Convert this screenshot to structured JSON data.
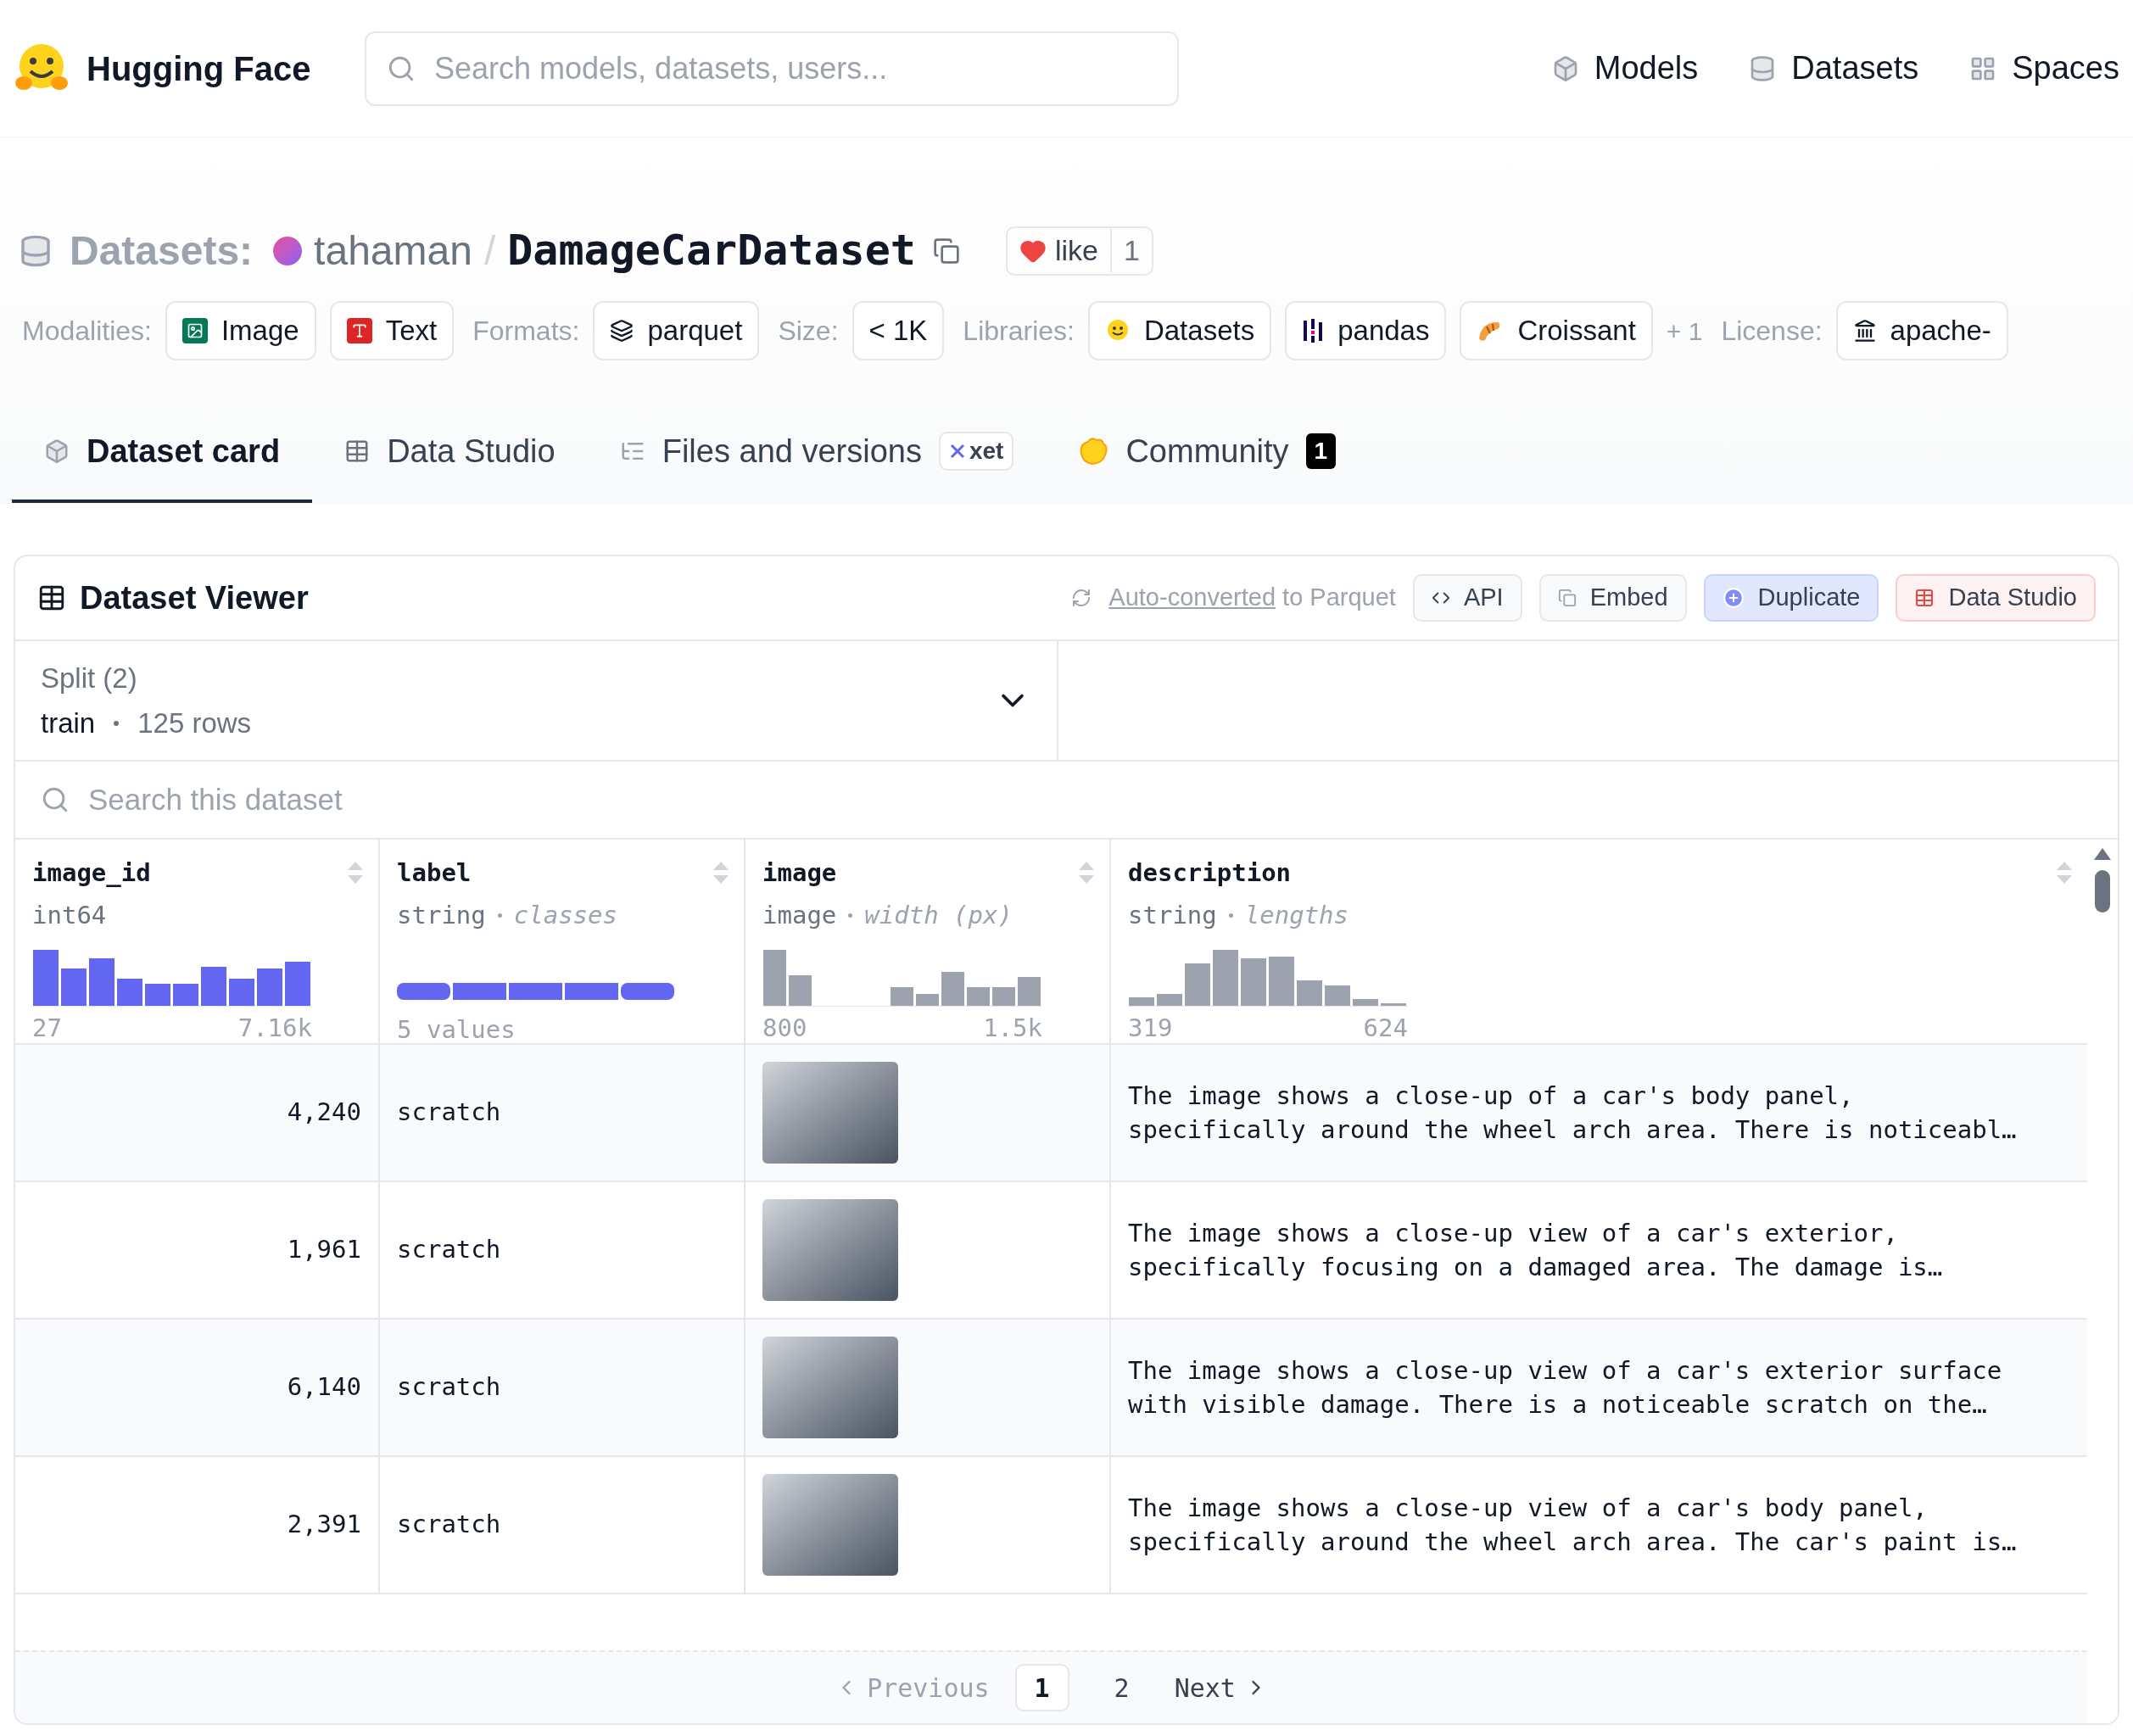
{
  "header": {
    "brand": "Hugging Face",
    "search": {
      "placeholder": "Search models, datasets, users..."
    },
    "nav": [
      {
        "label": "Models"
      },
      {
        "label": "Datasets"
      },
      {
        "label": "Spaces"
      }
    ]
  },
  "title": {
    "category": "Datasets:",
    "owner": "tahaman",
    "separator": "/",
    "name": "DamageCarDataset",
    "like_label": "like",
    "like_count": "1",
    "liked": true
  },
  "tags": [
    {
      "kind": "label",
      "text": "Modalities:"
    },
    {
      "kind": "chip",
      "text": "Image"
    },
    {
      "kind": "chip",
      "text": "Text"
    },
    {
      "kind": "label",
      "text": "Formats:"
    },
    {
      "kind": "chip",
      "text": "parquet"
    },
    {
      "kind": "label",
      "text": "Size:"
    },
    {
      "kind": "chip",
      "text": "< 1K"
    },
    {
      "kind": "label",
      "text": "Libraries:"
    },
    {
      "kind": "chip",
      "text": "Datasets"
    },
    {
      "kind": "chip",
      "text": "pandas"
    },
    {
      "kind": "chip",
      "text": "Croissant"
    },
    {
      "kind": "more",
      "text": "+ 1"
    },
    {
      "kind": "label",
      "text": "License:"
    },
    {
      "kind": "chip",
      "text": "apache-"
    }
  ],
  "tabs": [
    {
      "label": "Dataset card",
      "selected": true
    },
    {
      "label": "Data Studio",
      "selected": false
    },
    {
      "label": "Files and versions",
      "selected": false,
      "badge": "xet"
    },
    {
      "label": "Community",
      "selected": false,
      "count": "1"
    }
  ],
  "viewer": {
    "title": "Dataset Viewer",
    "converted_link": "Auto-converted",
    "converted_rest": "to Parquet",
    "buttons": [
      {
        "label": "API",
        "kind": "plain"
      },
      {
        "label": "Embed",
        "kind": "plain"
      },
      {
        "label": "Duplicate",
        "kind": "primary"
      },
      {
        "label": "Data Studio",
        "kind": "accent"
      }
    ],
    "split": {
      "label": "Split (2)",
      "value": "train",
      "rows": "125 rows"
    },
    "search": {
      "placeholder": "Search this dataset"
    },
    "columns": [
      {
        "name": "image_id",
        "type": "int64",
        "min": "27",
        "max": "7.16k"
      },
      {
        "name": "label",
        "type": "string",
        "stat": "classes",
        "summary": "5 values"
      },
      {
        "name": "image",
        "type": "image",
        "stat": "width (px)",
        "min": "800",
        "max": "1.5k"
      },
      {
        "name": "description",
        "type": "string",
        "stat": "lengths",
        "min": "319",
        "max": "624"
      }
    ],
    "rows": [
      {
        "image_id": "4,240",
        "label": "scratch",
        "description": "The image shows a close-up of a car's body panel, specifically around the wheel arch area. There is noticeabl…"
      },
      {
        "image_id": "1,961",
        "label": "scratch",
        "description": "The image shows a close-up view of a car's exterior, specifically focusing on a damaged area. The damage is…"
      },
      {
        "image_id": "6,140",
        "label": "scratch",
        "description": "The image shows a close-up view of a car's exterior surface with visible damage. There is a noticeable scratch on the…"
      },
      {
        "image_id": "2,391",
        "label": "scratch",
        "description": "The image shows a close-up view of a car's body panel, specifically around the wheel arch area. The car's paint is…"
      }
    ],
    "pagination": {
      "previous": "Previous",
      "previous_disabled": true,
      "pages": [
        {
          "label": "1",
          "selected": true
        },
        {
          "label": "2",
          "selected": false
        }
      ],
      "next": "Next"
    }
  }
}
